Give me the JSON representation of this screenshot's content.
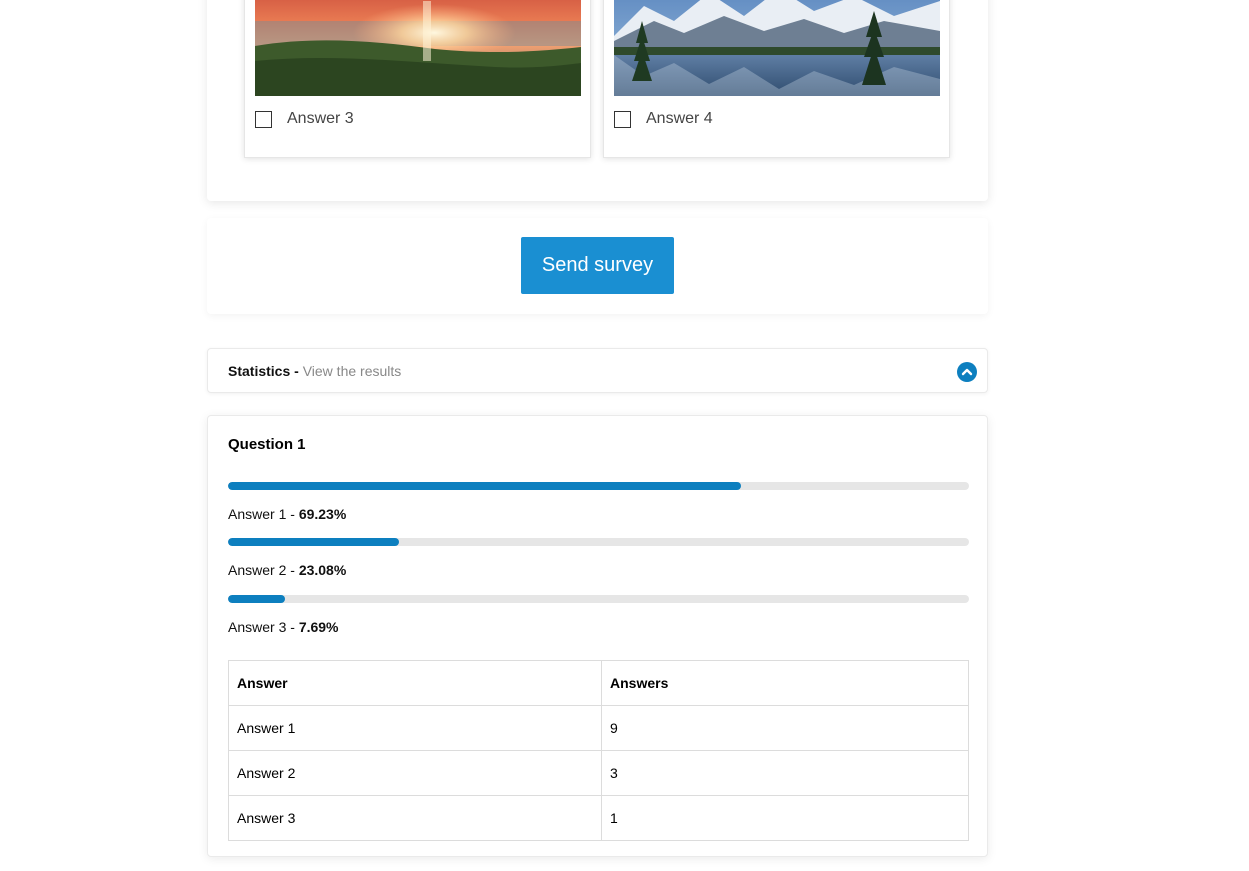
{
  "answer_tiles": [
    {
      "label": "Answer 3",
      "checked": false,
      "image": "sunset-over-sea-photo"
    },
    {
      "label": "Answer 4",
      "checked": false,
      "image": "mountain-lake-photo"
    }
  ],
  "send_button": {
    "label": "Send survey"
  },
  "statistics": {
    "title": "Statistics -",
    "subtitle": "View the results",
    "toggle_icon": "chevron-up-icon"
  },
  "question": {
    "title": "Question 1",
    "results": [
      {
        "answer": "Answer 1",
        "separator": " - ",
        "percent": "69.23%",
        "fraction": 0.6923
      },
      {
        "answer": "Answer 2",
        "separator": " - ",
        "percent": "23.08%",
        "fraction": 0.2308
      },
      {
        "answer": "Answer 3",
        "separator": " - ",
        "percent": "7.69%",
        "fraction": 0.0769
      }
    ]
  },
  "table": {
    "headers": [
      "Answer",
      "Answers"
    ],
    "rows": [
      [
        "Answer 1",
        "9"
      ],
      [
        "Answer 2",
        "3"
      ],
      [
        "Answer 3",
        "1"
      ]
    ]
  },
  "colors": {
    "accent": "#1a8fd2",
    "bar": "#0d7fbf",
    "track": "#e6e6e6"
  }
}
